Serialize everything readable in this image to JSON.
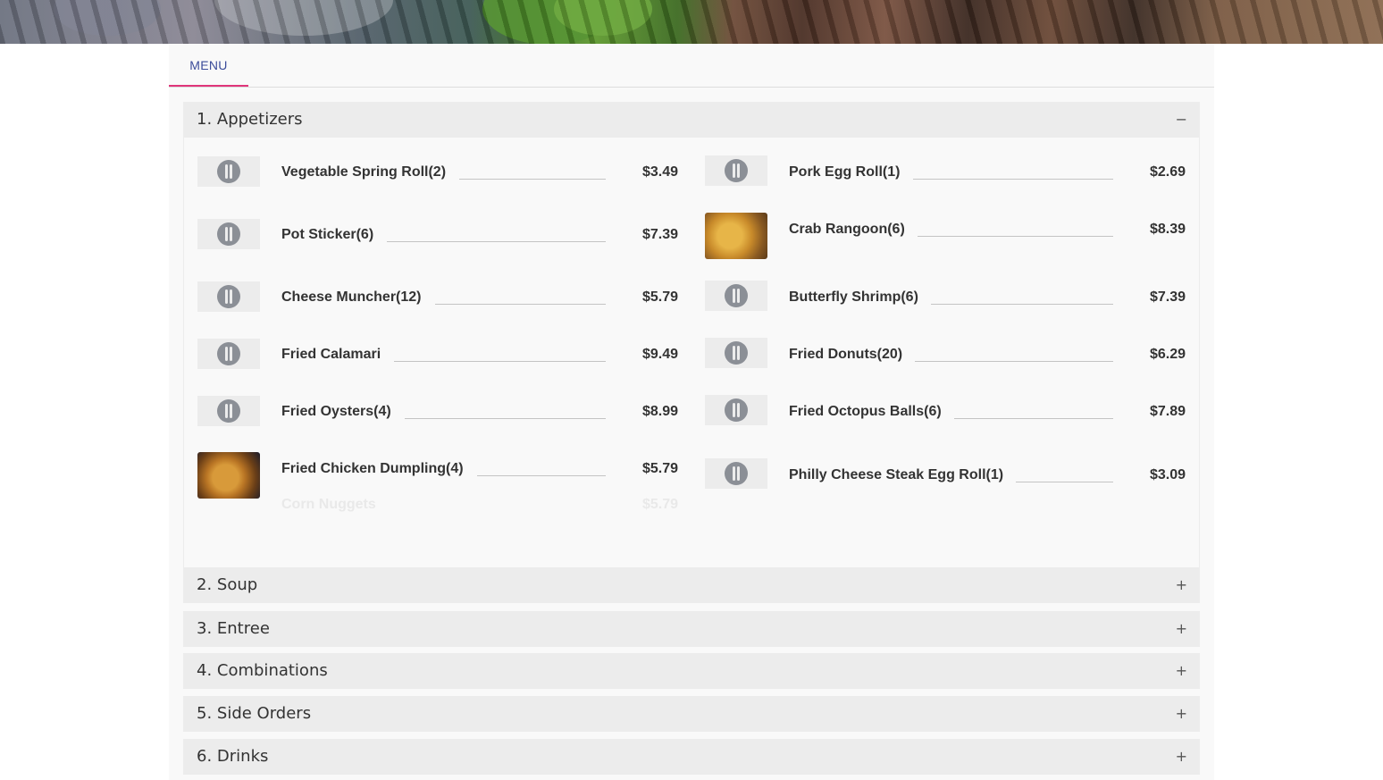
{
  "hero": {
    "image": "food-banner-photo"
  },
  "tabs": [
    {
      "label": "MENU",
      "active": true
    }
  ],
  "accent_color": "#e0357a",
  "tab_text_color": "#3b4c9a",
  "sections": [
    {
      "title": "1. Appetizers",
      "toggle": "−",
      "expanded": true
    },
    {
      "title": "2. Soup",
      "toggle": "+",
      "expanded": false
    },
    {
      "title": "3. Entree",
      "toggle": "+",
      "expanded": false
    },
    {
      "title": "4. Combinations",
      "toggle": "+",
      "expanded": false
    },
    {
      "title": "5. Side Orders",
      "toggle": "+",
      "expanded": false
    },
    {
      "title": "6. Drinks",
      "toggle": "+",
      "expanded": false
    }
  ],
  "appetizers": {
    "left": [
      {
        "name": "Vegetable Spring Roll(2)",
        "price": "$3.49",
        "image": "placeholder-fork-icon"
      },
      {
        "name": "Pot Sticker(6)",
        "price": "$7.39",
        "image": "placeholder-fork-icon"
      },
      {
        "name": "Cheese Muncher(12)",
        "price": "$5.79",
        "image": "placeholder-fork-icon"
      },
      {
        "name": "Fried Calamari",
        "price": "$9.49",
        "image": "placeholder-fork-icon"
      },
      {
        "name": "Fried Oysters(4)",
        "price": "$8.99",
        "image": "placeholder-fork-icon"
      },
      {
        "name": "Fried Chicken Dumpling(4)",
        "price": "$5.79",
        "image": "dumpling-photo"
      },
      {
        "name": "Corn Nuggets",
        "price": "$5.79",
        "image": "none",
        "faded": true
      }
    ],
    "right": [
      {
        "name": "Pork Egg Roll(1)",
        "price": "$2.69",
        "image": "placeholder-fork-icon"
      },
      {
        "name": "Crab Rangoon(6)",
        "price": "$8.39",
        "image": "crab-rangoon-photo"
      },
      {
        "name": "Butterfly Shrimp(6)",
        "price": "$7.39",
        "image": "placeholder-fork-icon"
      },
      {
        "name": "Fried Donuts(20)",
        "price": "$6.29",
        "image": "placeholder-fork-icon"
      },
      {
        "name": "Fried Octopus Balls(6)",
        "price": "$7.89",
        "image": "placeholder-fork-icon"
      },
      {
        "name": "Philly Cheese Steak Egg Roll(1)",
        "price": "$3.09",
        "image": "placeholder-fork-icon"
      }
    ]
  }
}
